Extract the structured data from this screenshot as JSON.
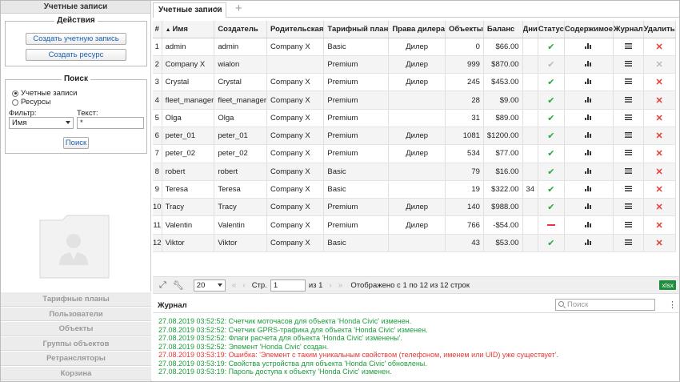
{
  "left": {
    "title": "Учетные записи",
    "actions": {
      "legend": "Действия",
      "create_account": "Создать учетную запись",
      "create_resource": "Создать ресурс"
    },
    "search": {
      "legend": "Поиск",
      "radio_accounts": "Учетные записи",
      "radio_resources": "Ресурсы",
      "filter_label": "Фильтр:",
      "filter_value": "Имя",
      "text_label": "Текст:",
      "text_value": "*",
      "button": "Поиск"
    },
    "nav": [
      "Тарифные планы",
      "Пользователи",
      "Объекты",
      "Группы объектов",
      "Ретрансляторы",
      "Корзина"
    ]
  },
  "tab": {
    "label": "Учетные записи",
    "close": "✕",
    "add": "+"
  },
  "table": {
    "headers": [
      "#",
      "Имя",
      "Создатель",
      "Родительская",
      "Тарифный план",
      "Права дилера",
      "Объекты",
      "Баланс",
      "Дни",
      "Статус",
      "Содержимое",
      "Журнал",
      "Удалить"
    ],
    "sort_indicator": "▲",
    "rows": [
      {
        "n": "1",
        "name": "admin",
        "creator": "admin",
        "parent": "Company X",
        "plan": "Basic",
        "dealer": "Дилер",
        "objects": "0",
        "balance": "$66.00",
        "days": "",
        "status": "ok",
        "delete": "active"
      },
      {
        "n": "2",
        "name": "Company X",
        "creator": "wialon",
        "parent": "",
        "plan": "Premium",
        "dealer": "Дилер",
        "objects": "999",
        "balance": "$870.00",
        "days": "",
        "status": "ok-gray",
        "delete": "disabled"
      },
      {
        "n": "3",
        "name": "Crystal",
        "creator": "Crystal",
        "parent": "Company X",
        "plan": "Premium",
        "dealer": "Дилер",
        "objects": "245",
        "balance": "$453.00",
        "days": "",
        "status": "ok",
        "delete": "active"
      },
      {
        "n": "4",
        "name": "fleet_manager",
        "creator": "fleet_manager",
        "parent": "Company X",
        "plan": "Premium",
        "dealer": "",
        "objects": "28",
        "balance": "$9.00",
        "days": "",
        "status": "ok",
        "delete": "active"
      },
      {
        "n": "5",
        "name": "Olga",
        "creator": "Olga",
        "parent": "Company X",
        "plan": "Premium",
        "dealer": "",
        "objects": "31",
        "balance": "$89.00",
        "days": "",
        "status": "ok",
        "delete": "active"
      },
      {
        "n": "6",
        "name": "peter_01",
        "creator": "peter_01",
        "parent": "Company X",
        "plan": "Premium",
        "dealer": "Дилер",
        "objects": "1081",
        "balance": "$1200.00",
        "days": "",
        "status": "ok",
        "delete": "active"
      },
      {
        "n": "7",
        "name": "peter_02",
        "creator": "peter_02",
        "parent": "Company X",
        "plan": "Premium",
        "dealer": "Дилер",
        "objects": "534",
        "balance": "$77.00",
        "days": "",
        "status": "ok",
        "delete": "active"
      },
      {
        "n": "8",
        "name": "robert",
        "creator": "robert",
        "parent": "Company X",
        "plan": "Basic",
        "dealer": "",
        "objects": "79",
        "balance": "$16.00",
        "days": "",
        "status": "ok",
        "delete": "active"
      },
      {
        "n": "9",
        "name": "Teresa",
        "creator": "Teresa",
        "parent": "Company X",
        "plan": "Basic",
        "dealer": "",
        "objects": "19",
        "balance": "$322.00",
        "days": "34",
        "status": "ok",
        "delete": "active"
      },
      {
        "n": "10",
        "name": "Tracy",
        "creator": "Tracy",
        "parent": "Company X",
        "plan": "Premium",
        "dealer": "Дилер",
        "objects": "140",
        "balance": "$988.00",
        "days": "",
        "status": "ok",
        "delete": "active"
      },
      {
        "n": "11",
        "name": "Valentin",
        "creator": "Valentin",
        "parent": "Company X",
        "plan": "Premium",
        "dealer": "Дилер",
        "objects": "766",
        "balance": "-$54.00",
        "days": "",
        "status": "blocked",
        "delete": "active"
      },
      {
        "n": "12",
        "name": "Viktor",
        "creator": "Viktor",
        "parent": "Company X",
        "plan": "Basic",
        "dealer": "",
        "objects": "43",
        "balance": "$53.00",
        "days": "",
        "status": "ok",
        "delete": "active"
      }
    ]
  },
  "pager": {
    "page_size": "20",
    "page_label": "Стр.",
    "page": "1",
    "of": "из 1",
    "summary": "Отображено с 1 по 12 из 12 строк",
    "export": "xlsx"
  },
  "journal": {
    "title": "Журнал",
    "search_placeholder": "Поиск",
    "entries": [
      {
        "text": "27.08.2019 03:52:52: Счетчик моточасов для объекта 'Honda Civic' изменен.",
        "type": "info"
      },
      {
        "text": "27.08.2019 03:52:52: Счетчик GPRS-трафика для объекта 'Honda Civic' изменен.",
        "type": "info"
      },
      {
        "text": "27.08.2019 03:52:52: Флаги расчета для объекта 'Honda Civic' изменены'.",
        "type": "info"
      },
      {
        "text": "27.08.2019 03:52:52: Элемент 'Honda Civic' создан.",
        "type": "info"
      },
      {
        "text": "27.08.2019 03:53:19: Ошибка: 'Элемент с таким уникальным свойством (телефоном, именем или UID) уже существует'.",
        "type": "error"
      },
      {
        "text": "27.08.2019 03:53:19: Свойства устройства для объекта 'Honda Civic' обновлены.",
        "type": "info"
      },
      {
        "text": "27.08.2019 03:53:19: Пароль доступа к объекту 'Honda Civic' изменен.",
        "type": "info"
      }
    ]
  }
}
